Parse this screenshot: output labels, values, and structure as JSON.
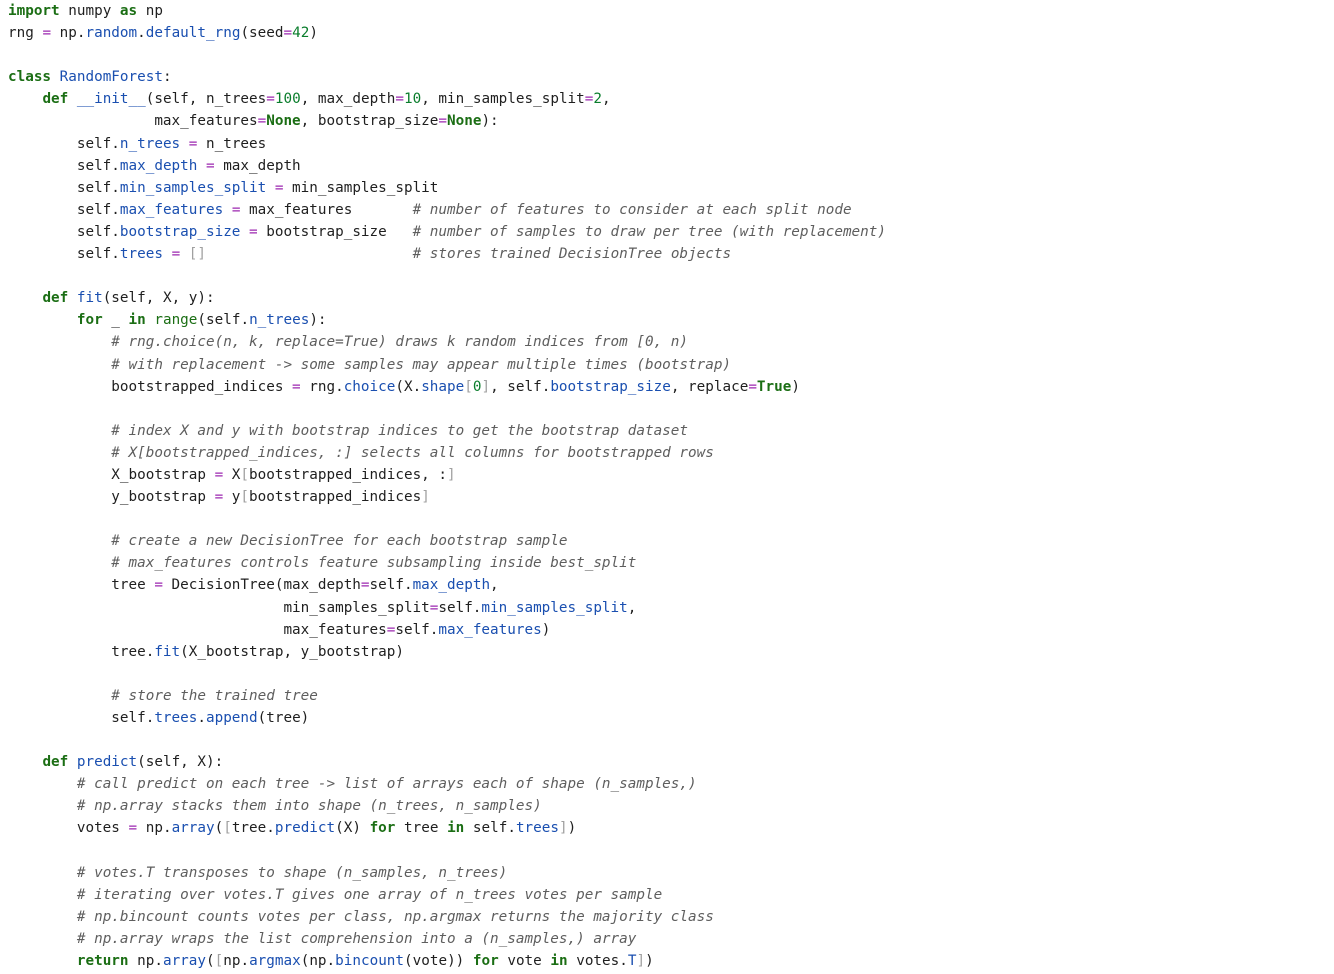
{
  "editor": {
    "language": "python",
    "colors": {
      "kw": "#1b6e14",
      "fn": "#1a4fb0",
      "bi": "#1b6e14",
      "num": "#0a7d2c",
      "op": "#9c27b0",
      "cm": "#5e5e5e",
      "br": "#a0a0a0",
      "pl": "#1f1f1f"
    },
    "lines": [
      [
        [
          "kw",
          "import"
        ],
        [
          "pl",
          " numpy "
        ],
        [
          "kw",
          "as"
        ],
        [
          "pl",
          " np"
        ]
      ],
      [
        [
          "pl",
          "rng "
        ],
        [
          "op",
          "="
        ],
        [
          "pl",
          " np."
        ],
        [
          "fn",
          "random"
        ],
        [
          "pl",
          "."
        ],
        [
          "fn",
          "default_rng"
        ],
        [
          "pl",
          "(seed"
        ],
        [
          "op",
          "="
        ],
        [
          "num",
          "42"
        ],
        [
          "pl",
          ")"
        ]
      ],
      [],
      [
        [
          "kw",
          "class"
        ],
        [
          "pl",
          " "
        ],
        [
          "fn",
          "RandomForest"
        ],
        [
          "pl",
          ":"
        ]
      ],
      [
        [
          "pl",
          "    "
        ],
        [
          "kw",
          "def"
        ],
        [
          "pl",
          " "
        ],
        [
          "fn",
          "__init__"
        ],
        [
          "pl",
          "(self, n_trees"
        ],
        [
          "op",
          "="
        ],
        [
          "num",
          "100"
        ],
        [
          "pl",
          ", max_depth"
        ],
        [
          "op",
          "="
        ],
        [
          "num",
          "10"
        ],
        [
          "pl",
          ", min_samples_split"
        ],
        [
          "op",
          "="
        ],
        [
          "num",
          "2"
        ],
        [
          "pl",
          ","
        ]
      ],
      [
        [
          "pl",
          "                 max_features"
        ],
        [
          "op",
          "="
        ],
        [
          "kw",
          "None"
        ],
        [
          "pl",
          ", bootstrap_size"
        ],
        [
          "op",
          "="
        ],
        [
          "kw",
          "None"
        ],
        [
          "pl",
          "):"
        ]
      ],
      [
        [
          "pl",
          "        self."
        ],
        [
          "fn",
          "n_trees"
        ],
        [
          "pl",
          " "
        ],
        [
          "op",
          "="
        ],
        [
          "pl",
          " n_trees"
        ]
      ],
      [
        [
          "pl",
          "        self."
        ],
        [
          "fn",
          "max_depth"
        ],
        [
          "pl",
          " "
        ],
        [
          "op",
          "="
        ],
        [
          "pl",
          " max_depth"
        ]
      ],
      [
        [
          "pl",
          "        self."
        ],
        [
          "fn",
          "min_samples_split"
        ],
        [
          "pl",
          " "
        ],
        [
          "op",
          "="
        ],
        [
          "pl",
          " min_samples_split"
        ]
      ],
      [
        [
          "pl",
          "        self."
        ],
        [
          "fn",
          "max_features"
        ],
        [
          "pl",
          " "
        ],
        [
          "op",
          "="
        ],
        [
          "pl",
          " max_features       "
        ],
        [
          "cm",
          "# number of features to consider at each split node"
        ]
      ],
      [
        [
          "pl",
          "        self."
        ],
        [
          "fn",
          "bootstrap_size"
        ],
        [
          "pl",
          " "
        ],
        [
          "op",
          "="
        ],
        [
          "pl",
          " bootstrap_size   "
        ],
        [
          "cm",
          "# number of samples to draw per tree (with replacement)"
        ]
      ],
      [
        [
          "pl",
          "        self."
        ],
        [
          "fn",
          "trees"
        ],
        [
          "pl",
          " "
        ],
        [
          "op",
          "="
        ],
        [
          "pl",
          " "
        ],
        [
          "br",
          "[]"
        ],
        [
          "pl",
          "                        "
        ],
        [
          "cm",
          "# stores trained DecisionTree objects"
        ]
      ],
      [],
      [
        [
          "pl",
          "    "
        ],
        [
          "kw",
          "def"
        ],
        [
          "pl",
          " "
        ],
        [
          "fn",
          "fit"
        ],
        [
          "pl",
          "(self, X, y):"
        ]
      ],
      [
        [
          "pl",
          "        "
        ],
        [
          "kw",
          "for"
        ],
        [
          "pl",
          " _ "
        ],
        [
          "kw",
          "in"
        ],
        [
          "pl",
          " "
        ],
        [
          "bi",
          "range"
        ],
        [
          "pl",
          "(self."
        ],
        [
          "fn",
          "n_trees"
        ],
        [
          "pl",
          "):"
        ]
      ],
      [
        [
          "pl",
          "            "
        ],
        [
          "cm",
          "# rng.choice(n, k, replace=True) draws k random indices from [0, n)"
        ]
      ],
      [
        [
          "pl",
          "            "
        ],
        [
          "cm",
          "# with replacement -> some samples may appear multiple times (bootstrap)"
        ]
      ],
      [
        [
          "pl",
          "            bootstrapped_indices "
        ],
        [
          "op",
          "="
        ],
        [
          "pl",
          " rng."
        ],
        [
          "fn",
          "choice"
        ],
        [
          "pl",
          "(X."
        ],
        [
          "fn",
          "shape"
        ],
        [
          "br",
          "["
        ],
        [
          "num",
          "0"
        ],
        [
          "br",
          "]"
        ],
        [
          "pl",
          ", self."
        ],
        [
          "fn",
          "bootstrap_size"
        ],
        [
          "pl",
          ", replace"
        ],
        [
          "op",
          "="
        ],
        [
          "kw",
          "True"
        ],
        [
          "pl",
          ")"
        ]
      ],
      [],
      [
        [
          "pl",
          "            "
        ],
        [
          "cm",
          "# index X and y with bootstrap indices to get the bootstrap dataset"
        ]
      ],
      [
        [
          "pl",
          "            "
        ],
        [
          "cm",
          "# X[bootstrapped_indices, :] selects all columns for bootstrapped rows"
        ]
      ],
      [
        [
          "pl",
          "            X_bootstrap "
        ],
        [
          "op",
          "="
        ],
        [
          "pl",
          " X"
        ],
        [
          "br",
          "["
        ],
        [
          "pl",
          "bootstrapped_indices, :"
        ],
        [
          "br",
          "]"
        ]
      ],
      [
        [
          "pl",
          "            y_bootstrap "
        ],
        [
          "op",
          "="
        ],
        [
          "pl",
          " y"
        ],
        [
          "br",
          "["
        ],
        [
          "pl",
          "bootstrapped_indices"
        ],
        [
          "br",
          "]"
        ]
      ],
      [],
      [
        [
          "pl",
          "            "
        ],
        [
          "cm",
          "# create a new DecisionTree for each bootstrap sample"
        ]
      ],
      [
        [
          "pl",
          "            "
        ],
        [
          "cm",
          "# max_features controls feature subsampling inside best_split"
        ]
      ],
      [
        [
          "pl",
          "            tree "
        ],
        [
          "op",
          "="
        ],
        [
          "pl",
          " DecisionTree(max_depth"
        ],
        [
          "op",
          "="
        ],
        [
          "pl",
          "self."
        ],
        [
          "fn",
          "max_depth"
        ],
        [
          "pl",
          ","
        ]
      ],
      [
        [
          "pl",
          "                                min_samples_split"
        ],
        [
          "op",
          "="
        ],
        [
          "pl",
          "self."
        ],
        [
          "fn",
          "min_samples_split"
        ],
        [
          "pl",
          ","
        ]
      ],
      [
        [
          "pl",
          "                                max_features"
        ],
        [
          "op",
          "="
        ],
        [
          "pl",
          "self."
        ],
        [
          "fn",
          "max_features"
        ],
        [
          "pl",
          ")"
        ]
      ],
      [
        [
          "pl",
          "            tree."
        ],
        [
          "fn",
          "fit"
        ],
        [
          "pl",
          "(X_bootstrap, y_bootstrap)"
        ]
      ],
      [],
      [
        [
          "pl",
          "            "
        ],
        [
          "cm",
          "# store the trained tree"
        ]
      ],
      [
        [
          "pl",
          "            self."
        ],
        [
          "fn",
          "trees"
        ],
        [
          "pl",
          "."
        ],
        [
          "fn",
          "append"
        ],
        [
          "pl",
          "(tree)"
        ]
      ],
      [],
      [
        [
          "pl",
          "    "
        ],
        [
          "kw",
          "def"
        ],
        [
          "pl",
          " "
        ],
        [
          "fn",
          "predict"
        ],
        [
          "pl",
          "(self, X):"
        ]
      ],
      [
        [
          "pl",
          "        "
        ],
        [
          "cm",
          "# call predict on each tree -> list of arrays each of shape (n_samples,)"
        ]
      ],
      [
        [
          "pl",
          "        "
        ],
        [
          "cm",
          "# np.array stacks them into shape (n_trees, n_samples)"
        ]
      ],
      [
        [
          "pl",
          "        votes "
        ],
        [
          "op",
          "="
        ],
        [
          "pl",
          " np."
        ],
        [
          "fn",
          "array"
        ],
        [
          "pl",
          "("
        ],
        [
          "br",
          "["
        ],
        [
          "pl",
          "tree."
        ],
        [
          "fn",
          "predict"
        ],
        [
          "pl",
          "(X) "
        ],
        [
          "kw",
          "for"
        ],
        [
          "pl",
          " tree "
        ],
        [
          "kw",
          "in"
        ],
        [
          "pl",
          " self."
        ],
        [
          "fn",
          "trees"
        ],
        [
          "br",
          "]"
        ],
        [
          "pl",
          ")"
        ]
      ],
      [],
      [
        [
          "pl",
          "        "
        ],
        [
          "cm",
          "# votes.T transposes to shape (n_samples, n_trees)"
        ]
      ],
      [
        [
          "pl",
          "        "
        ],
        [
          "cm",
          "# iterating over votes.T gives one array of n_trees votes per sample"
        ]
      ],
      [
        [
          "pl",
          "        "
        ],
        [
          "cm",
          "# np.bincount counts votes per class, np.argmax returns the majority class"
        ]
      ],
      [
        [
          "pl",
          "        "
        ],
        [
          "cm",
          "# np.array wraps the list comprehension into a (n_samples,) array"
        ]
      ],
      [
        [
          "pl",
          "        "
        ],
        [
          "kw",
          "return"
        ],
        [
          "pl",
          " np."
        ],
        [
          "fn",
          "array"
        ],
        [
          "pl",
          "("
        ],
        [
          "br",
          "["
        ],
        [
          "pl",
          "np."
        ],
        [
          "fn",
          "argmax"
        ],
        [
          "pl",
          "(np."
        ],
        [
          "fn",
          "bincount"
        ],
        [
          "pl",
          "(vote)) "
        ],
        [
          "kw",
          "for"
        ],
        [
          "pl",
          " vote "
        ],
        [
          "kw",
          "in"
        ],
        [
          "pl",
          " votes."
        ],
        [
          "fn",
          "T"
        ],
        [
          "br",
          "]"
        ],
        [
          "pl",
          ")"
        ]
      ]
    ]
  }
}
